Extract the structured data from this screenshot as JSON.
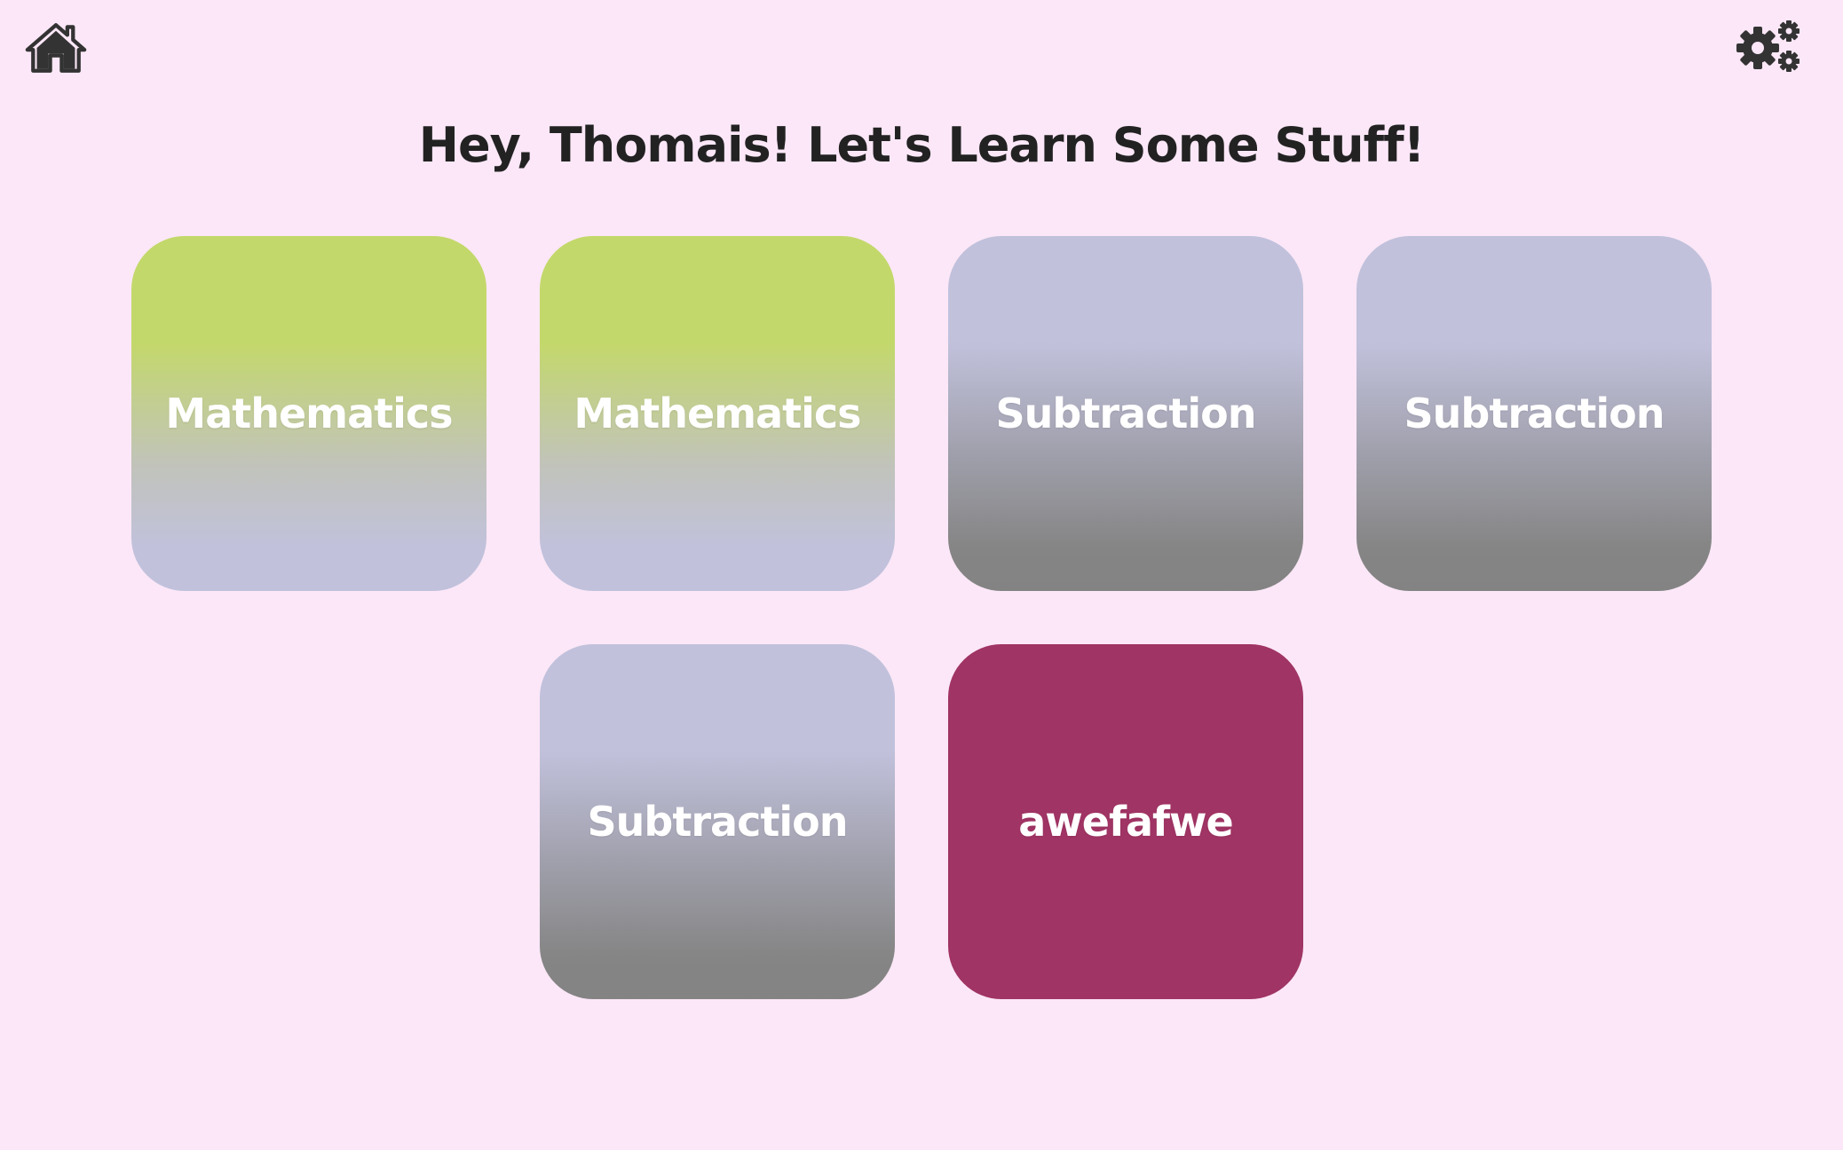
{
  "header": {
    "home_icon": "home-icon",
    "settings_icon": "gears-icon",
    "title": "Hey, Thomais! Let's Learn Some Stuff!"
  },
  "colors": {
    "background": "#fbe7f7",
    "green": "#c3d86b",
    "lavender": "#c1c1dc",
    "grey": "#838383",
    "maroon": "#a03464",
    "icon": "#333333"
  },
  "tiles": [
    {
      "label": "Mathematics",
      "style": "green"
    },
    {
      "label": "Mathematics",
      "style": "green"
    },
    {
      "label": "Subtraction",
      "style": "grey"
    },
    {
      "label": "Subtraction",
      "style": "grey"
    },
    {
      "label": "Subtraction",
      "style": "grey"
    },
    {
      "label": "awefafwe",
      "style": "maroon"
    }
  ]
}
